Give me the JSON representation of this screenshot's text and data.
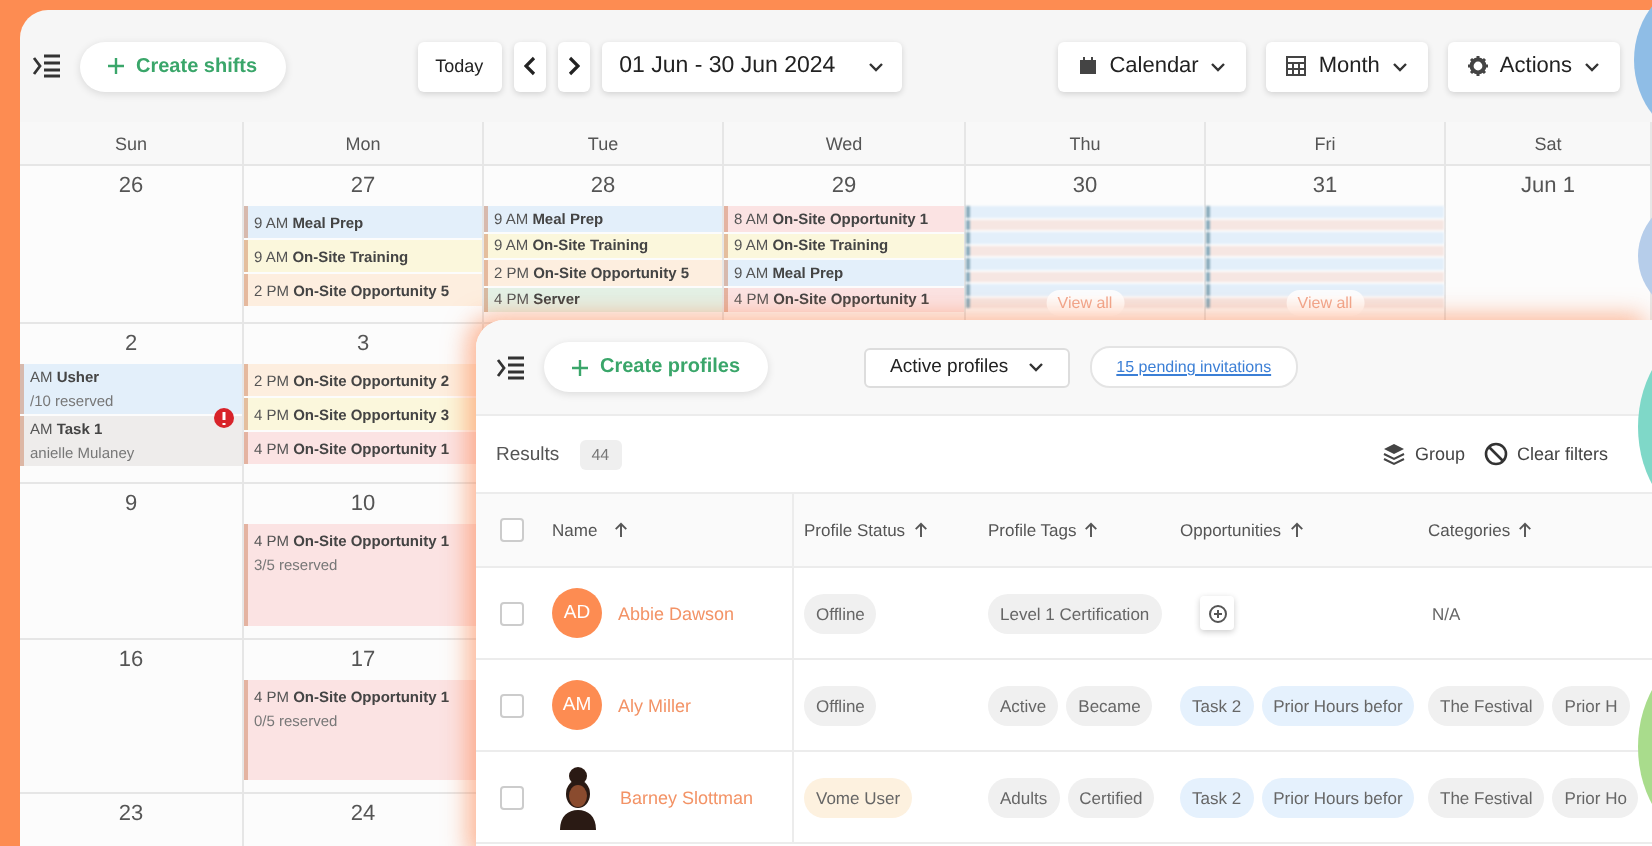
{
  "toolbar": {
    "create_button": "Create shifts",
    "today_button": "Today",
    "date_range": "01 Jun - 30 Jun 2024",
    "views": [
      {
        "label": "Calendar",
        "kind": "calendar"
      },
      {
        "label": "Month",
        "kind": "grid"
      },
      {
        "label": "Actions",
        "kind": "gear"
      }
    ]
  },
  "calendar": {
    "day_headers": [
      "Sun",
      "Mon",
      "Tue",
      "Wed",
      "Thu",
      "Fri",
      "Sat"
    ],
    "weeks": [
      {
        "days": [
          {
            "date": "26"
          },
          {
            "date": "27",
            "events": [
              {
                "time": "9 AM",
                "title": "Meal Prep",
                "color": "#e3effa",
                "alert": false
              },
              {
                "time": "9 AM",
                "title": "On-Site Training",
                "color": "#fbf7dc",
                "alert": false
              },
              {
                "time": "2 PM",
                "title": "On-Site Opportunity 5",
                "color": "#fdeedf",
                "alert": false
              }
            ]
          },
          {
            "date": "28",
            "events": [
              {
                "time": "9 AM",
                "title": "Meal Prep",
                "color": "#e3effa",
                "alert": false
              },
              {
                "time": "9 AM",
                "title": "On-Site Training",
                "color": "#fbf7dc",
                "alert": false
              },
              {
                "time": "2 PM",
                "title": "On-Site Opportunity 5",
                "color": "#fdeedf",
                "alert": false
              },
              {
                "time": "4 PM",
                "title": "Server",
                "color": "#e3f1e6",
                "alert": false
              }
            ]
          },
          {
            "date": "29",
            "events": [
              {
                "time": "8 AM",
                "title": "On-Site Opportunity 1",
                "color": "#fbe3e3",
                "alert": false
              },
              {
                "time": "9 AM",
                "title": "On-Site Training",
                "color": "#fbf7dc",
                "alert": false
              },
              {
                "time": "9 AM",
                "title": "Meal Prep",
                "color": "#e3effa",
                "alert": false
              },
              {
                "time": "4 PM",
                "title": "On-Site Opportunity 1",
                "color": "#fbe3e3",
                "alert": false
              }
            ]
          },
          {
            "date": "30",
            "kind": "collapsed",
            "view_all": "View all"
          },
          {
            "date": "31",
            "kind": "collapsed",
            "view_all": "View all"
          },
          {
            "date": "Jun 1"
          }
        ]
      },
      {
        "days": [
          {
            "date": "2",
            "events": [
              {
                "time": "AM",
                "title": "Usher",
                "detail": "/10 reserved",
                "color": "#e3effa",
                "alert": false
              },
              {
                "time": "AM",
                "title": "Task 1",
                "detail": "anielle Mulaney",
                "color": "#eeeceb",
                "alert": true
              }
            ]
          },
          {
            "date": "3",
            "events": [
              {
                "time": "2 PM",
                "title": "On-Site Opportunity 2",
                "color": "#fdeedf",
                "alert": false
              },
              {
                "time": "4 PM",
                "title": "On-Site Opportunity 3",
                "color": "#fbf7dc",
                "alert": false
              },
              {
                "time": "4 PM",
                "title": "On-Site Opportunity 1",
                "color": "#fbe3e3",
                "alert": false
              }
            ]
          }
        ]
      },
      {
        "days": [
          {
            "date": "9"
          },
          {
            "date": "10",
            "events": [
              {
                "time": "4 PM",
                "title": "On-Site Opportunity 1",
                "detail": "3/5 reserved",
                "color": "#fbe3e3",
                "alert": false
              }
            ]
          }
        ]
      },
      {
        "days": [
          {
            "date": "16"
          },
          {
            "date": "17",
            "events": [
              {
                "time": "4 PM",
                "title": "On-Site Opportunity 1",
                "detail": "0/5 reserved",
                "color": "#fbe3e3",
                "alert": false
              }
            ]
          }
        ]
      },
      {
        "days": [
          {
            "date": "23"
          },
          {
            "date": "24"
          }
        ]
      }
    ]
  },
  "panel": {
    "create_button": "Create profiles",
    "filter": "Active profiles",
    "invitations_link": "15 pending invitations",
    "results_label": "Results",
    "results_count": "44",
    "actions": [
      {
        "label": "Group",
        "kind": "layers"
      },
      {
        "label": "Clear filters",
        "kind": "ban"
      }
    ],
    "header_checked": false,
    "columns": [
      "Name",
      "Profile Status",
      "Profile Tags",
      "Opportunities",
      "Categories"
    ],
    "rows": [
      {
        "checked": false,
        "avatar": {
          "kind": "initials",
          "initials": "AD",
          "color": "#fd8c52"
        },
        "name": "Abbie Dawson",
        "status": {
          "label": "Offline",
          "kind": "offline"
        },
        "tags": [
          "Level 1 Certification"
        ],
        "category_note": "N/A"
      },
      {
        "checked": false,
        "avatar": {
          "kind": "initials",
          "initials": "AM",
          "color": "#fd8c52"
        },
        "name": "Aly Miller",
        "status": {
          "label": "Offline",
          "kind": "offline"
        },
        "tags": [
          "Active",
          "Became"
        ],
        "opportunities": [
          "Task 2",
          "Prior Hours befor"
        ],
        "categories": [
          "The Festival",
          "Prior H"
        ]
      },
      {
        "checked": false,
        "avatar": {
          "kind": "picture"
        },
        "name": "Barney Slottman",
        "status": {
          "label": "Vome User",
          "kind": "user"
        },
        "tags": [
          "Adults",
          "Certified"
        ],
        "opportunities": [
          "Task 2",
          "Prior Hours befor"
        ],
        "categories": [
          "The Festival",
          "Prior Ho"
        ]
      }
    ]
  }
}
